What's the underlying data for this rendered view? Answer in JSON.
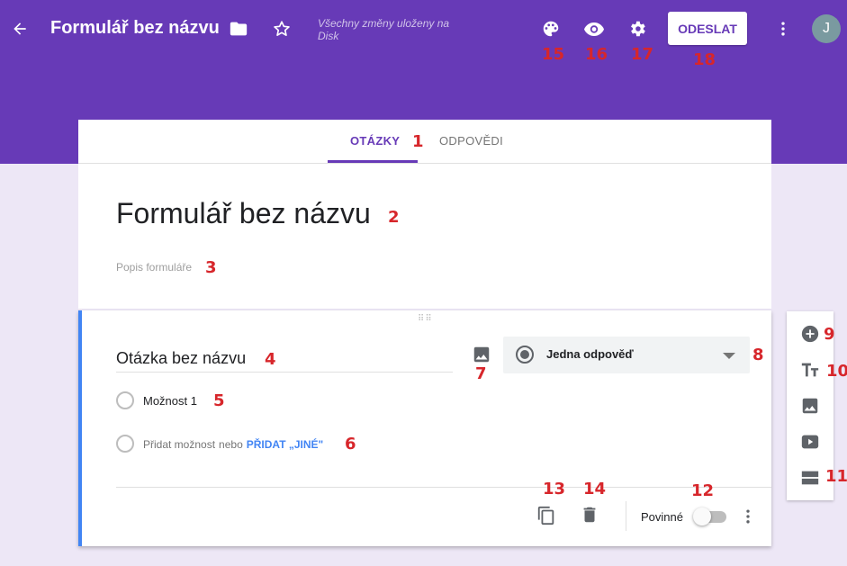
{
  "topbar": {
    "title": "Formulář bez názvu",
    "saved_status": "Všechny změny uloženy na Disk",
    "send_label": "ODESLAT",
    "avatar_letter": "J",
    "accent_color": "#673ab7"
  },
  "tabs": [
    {
      "label": "OTÁZKY",
      "active": true
    },
    {
      "label": "ODPOVĚDI",
      "active": false
    }
  ],
  "form": {
    "title": "Formulář bez názvu",
    "description_placeholder": "Popis formuláře"
  },
  "question": {
    "title": "Otázka bez názvu",
    "type_label": "Jedna odpověď",
    "option1": "Možnost 1",
    "add_option": "Přidat možnost",
    "or": "nebo",
    "add_other": "PŘIDAT „JINÉ\"",
    "required_label": "Povinné",
    "required": false
  },
  "icons": [
    "back-arrow-icon",
    "folder-icon",
    "star-icon",
    "palette-icon",
    "eye-icon",
    "gear-icon",
    "more-vert-icon",
    "drag-handle-icon",
    "image-icon",
    "copy-icon",
    "trash-icon",
    "add-circle-icon",
    "title-icon",
    "video-icon",
    "section-icon"
  ],
  "markers": {
    "m1": "1",
    "m2": "2",
    "m3": "3",
    "m4": "4",
    "m5": "5",
    "m6": "6",
    "m7": "7",
    "m8": "8",
    "m9": "9",
    "m10": "10",
    "m11": "11",
    "m12": "12",
    "m13": "13",
    "m14": "14",
    "m15": "15",
    "m16": "16",
    "m17": "17",
    "m18": "18"
  }
}
